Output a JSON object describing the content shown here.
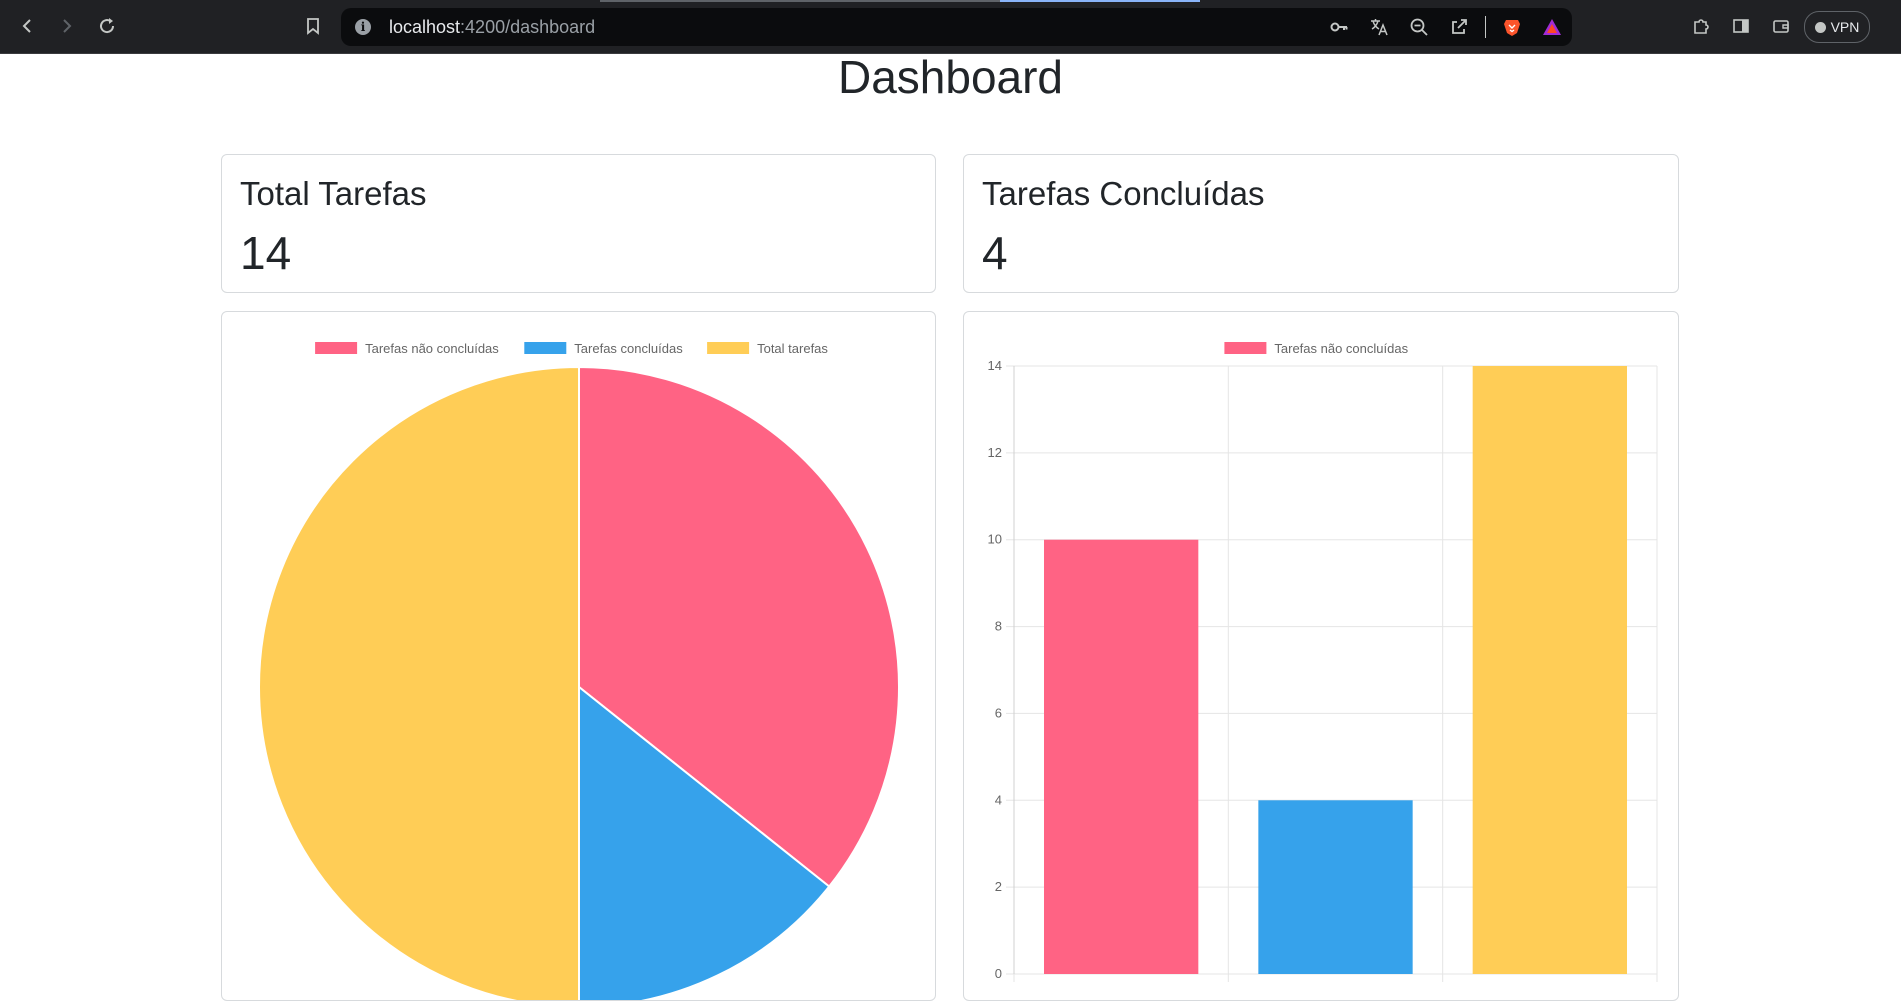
{
  "browser": {
    "url_host": "localhost",
    "url_rest": ":4200/dashboard",
    "vpn_label": "VPN"
  },
  "page": {
    "title": "Dashboard"
  },
  "cards": [
    {
      "title": "Total Tarefas",
      "value": "14"
    },
    {
      "title": "Tarefas Concluídas",
      "value": "4"
    }
  ],
  "colors": {
    "pink": "#ff6384",
    "blue": "#36a2eb",
    "yellow": "#ffcd56"
  },
  "chart_data": [
    {
      "type": "pie",
      "labels": [
        "Tarefas não concluídas",
        "Tarefas concluídas",
        "Total tarefas"
      ],
      "values": [
        10,
        4,
        14
      ],
      "colors": [
        "#ff6384",
        "#36a2eb",
        "#ffcd56"
      ],
      "legend": "top"
    },
    {
      "type": "bar",
      "categories": [
        "",
        "",
        ""
      ],
      "series": [
        {
          "name": "Tarefas não concluídas",
          "values": [
            10,
            4,
            14
          ]
        }
      ],
      "bar_colors": [
        "#ff6384",
        "#36a2eb",
        "#ffcd56"
      ],
      "ylim": [
        0,
        14
      ],
      "yticks": [
        0,
        2,
        4,
        6,
        8,
        10,
        12,
        14
      ],
      "grid": true,
      "legend": "top"
    }
  ]
}
